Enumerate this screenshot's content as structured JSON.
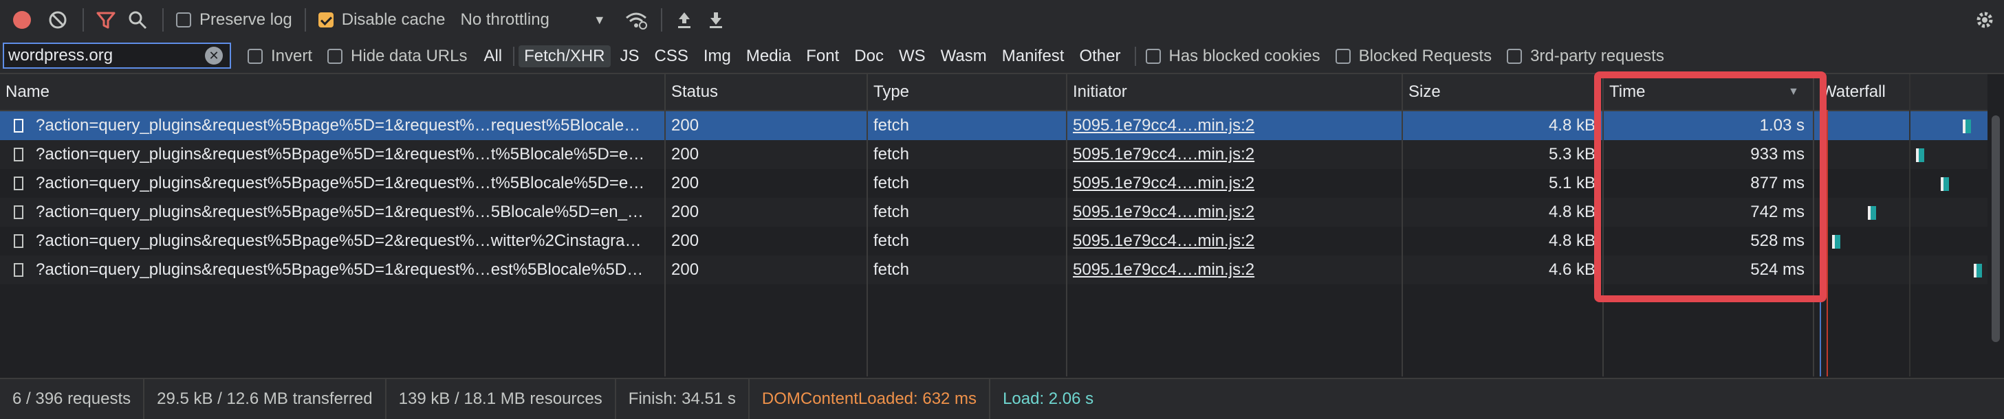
{
  "toolbar": {
    "preserve_log_label": "Preserve log",
    "disable_cache_label": "Disable cache",
    "throttling_value": "No throttling"
  },
  "filter": {
    "value": "wordpress.org",
    "invert_label": "Invert",
    "hide_data_urls_label": "Hide data URLs",
    "types": [
      "All",
      "Fetch/XHR",
      "JS",
      "CSS",
      "Img",
      "Media",
      "Font",
      "Doc",
      "WS",
      "Wasm",
      "Manifest",
      "Other"
    ],
    "active_type": "Fetch/XHR",
    "has_blocked_cookies_label": "Has blocked cookies",
    "blocked_requests_label": "Blocked Requests",
    "third_party_label": "3rd-party requests"
  },
  "columns": {
    "name": "Name",
    "status": "Status",
    "type": "Type",
    "initiator": "Initiator",
    "size": "Size",
    "time": "Time",
    "waterfall": "Waterfall"
  },
  "rows": [
    {
      "name": "?action=query_plugins&request%5Bpage%5D=1&request%…request%5Blocale…",
      "status": "200",
      "type": "fetch",
      "initiator": "5095.1e79cc4….min.js:2",
      "size": "4.8 kB",
      "time": "1.03 s"
    },
    {
      "name": "?action=query_plugins&request%5Bpage%5D=1&request%…t%5Blocale%5D=e…",
      "status": "200",
      "type": "fetch",
      "initiator": "5095.1e79cc4….min.js:2",
      "size": "5.3 kB",
      "time": "933 ms"
    },
    {
      "name": "?action=query_plugins&request%5Bpage%5D=1&request%…t%5Blocale%5D=e…",
      "status": "200",
      "type": "fetch",
      "initiator": "5095.1e79cc4….min.js:2",
      "size": "5.1 kB",
      "time": "877 ms"
    },
    {
      "name": "?action=query_plugins&request%5Bpage%5D=1&request%…5Blocale%5D=en_…",
      "status": "200",
      "type": "fetch",
      "initiator": "5095.1e79cc4….min.js:2",
      "size": "4.8 kB",
      "time": "742 ms"
    },
    {
      "name": "?action=query_plugins&request%5Bpage%5D=2&request%…witter%2Cinstagra…",
      "status": "200",
      "type": "fetch",
      "initiator": "5095.1e79cc4….min.js:2",
      "size": "4.8 kB",
      "time": "528 ms"
    },
    {
      "name": "?action=query_plugins&request%5Bpage%5D=1&request%…est%5Blocale%5D…",
      "status": "200",
      "type": "fetch",
      "initiator": "5095.1e79cc4….min.js:2",
      "size": "4.6 kB",
      "time": "524 ms"
    }
  ],
  "status_bar": {
    "requests": "6 / 396 requests",
    "transferred": "29.5 kB / 12.6 MB transferred",
    "resources": "139 kB / 18.1 MB resources",
    "finish": "Finish: 34.51 s",
    "dom_content_loaded": "DOMContentLoaded: 632 ms",
    "load": "Load: 2.06 s"
  },
  "colors": {
    "highlight": "#e2474e",
    "selected_row": "#2e5e9e",
    "dom_content_loaded": "#f0924a",
    "load": "#6fd6d0",
    "record_button": "#e46962",
    "filter_icon": "#e46962"
  }
}
